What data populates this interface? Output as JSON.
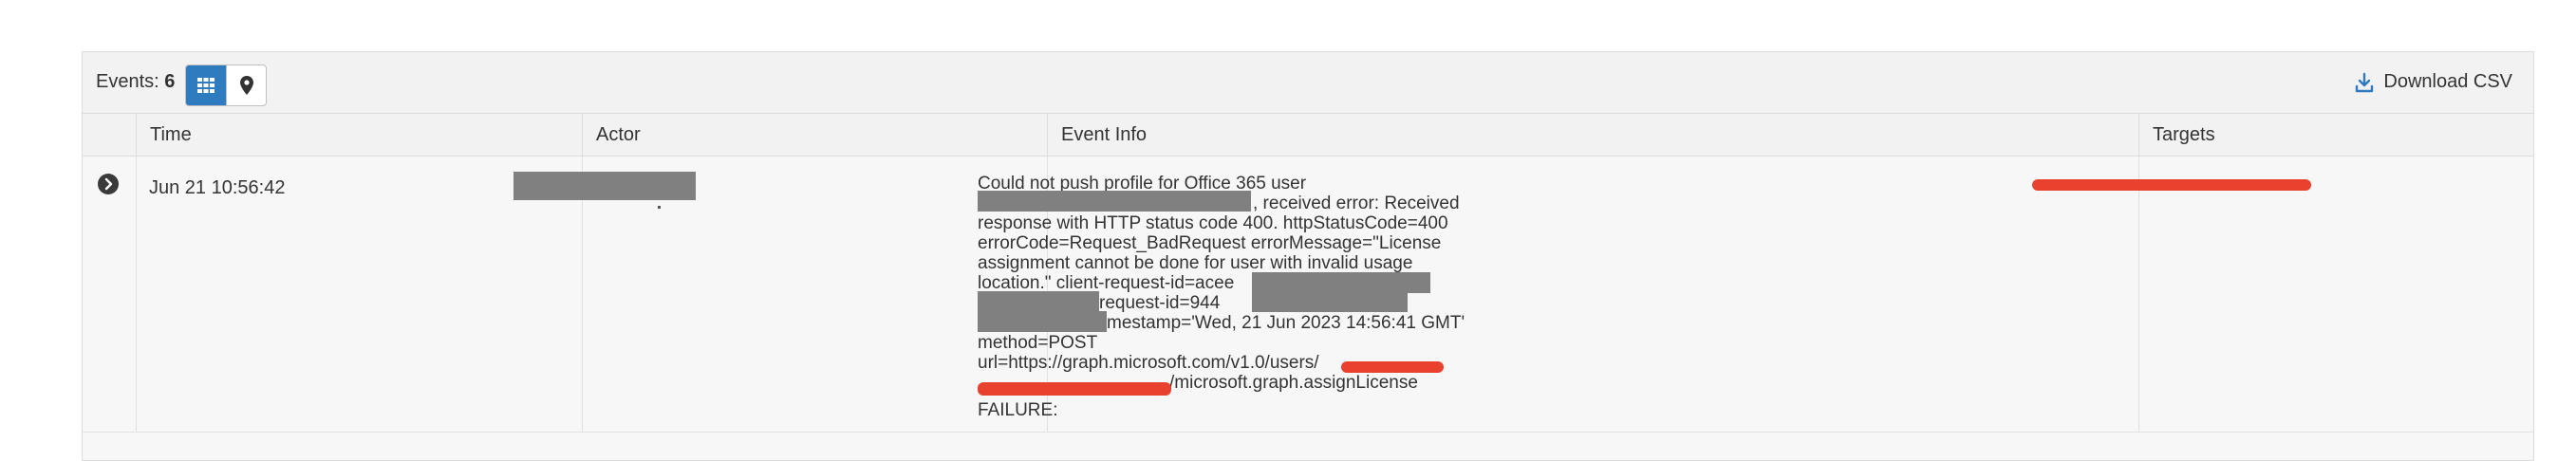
{
  "toolbar": {
    "events_label": "Events:",
    "events_count": "6",
    "view_grid_icon": "grid-icon",
    "view_map_icon": "map-pin-icon",
    "download_label": "Download CSV",
    "download_icon": "download-icon"
  },
  "table": {
    "columns": [
      "",
      "Time",
      "Actor",
      "Event Info",
      "Targets"
    ],
    "rows": [
      {
        "time": "Jun 21 10:56:42",
        "event_info_lines": [
          "Could not push profile for Office 365 user",
          ", received error: Received",
          "response with HTTP status code 400. httpStatusCode=400",
          "errorCode=Request_BadRequest errorMessage=\"License",
          "assignment cannot be done for user with invalid usage",
          "location.\" client-request-id=acee",
          "request-id=944",
          "mestamp='Wed, 21 Jun 2023 14:56:41 GMT'",
          "method=POST",
          "url=https://graph.microsoft.com/v1.0/users/",
          "/microsoft.graph.assignLicense"
        ],
        "status": "FAILURE:"
      }
    ]
  },
  "colors": {
    "accent": "#2e7bc0",
    "redaction_gray": "#808080",
    "redaction_red": "#e8412e"
  }
}
